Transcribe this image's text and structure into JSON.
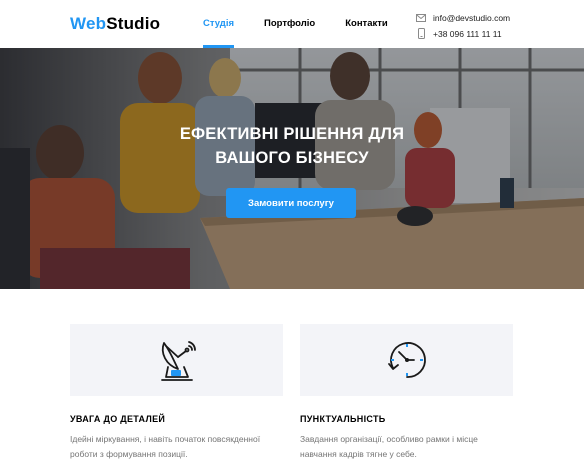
{
  "header": {
    "logo_part1": "Web",
    "logo_part2": "Studio",
    "nav": [
      {
        "label": "Студія",
        "active": true
      },
      {
        "label": "Портфоліо",
        "active": false
      },
      {
        "label": "Контакти",
        "active": false
      }
    ],
    "email": "info@devstudio.com",
    "phone": "+38 096 111 11 11"
  },
  "hero": {
    "title_line1": "Ефективні рішення для",
    "title_line2": "вашого бізнесу",
    "button_label": "Замовити послугу"
  },
  "features": [
    {
      "title": "Увага до деталей",
      "text": "Ідейні міркування, і навіть початок повсякденної роботи з формування позиції.",
      "icon": "satellite-dish-icon"
    },
    {
      "title": "Пунктуальність",
      "text": "Завдання організації, особливо рамки і місце навчання кадрів тягне у себе.",
      "icon": "clock-icon"
    }
  ],
  "colors": {
    "accent": "#2196f3",
    "feature_bg": "#f3f4f8"
  }
}
